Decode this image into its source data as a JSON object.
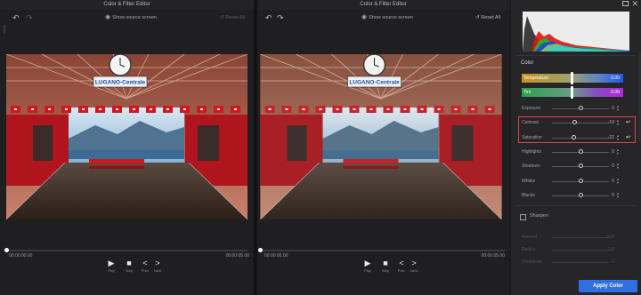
{
  "left_pane": {
    "title": "Color & Filter Editor",
    "show_source": "Show source screen",
    "reset_all": "Reset All",
    "time_start": "00:00:00.00",
    "time_end": "00:00:05.00"
  },
  "right_pane": {
    "title": "Color & Filter Editor",
    "show_source": "Show source screen",
    "reset_all": "Reset All",
    "time_start": "00:00:00.00",
    "time_end": "00:00:05.00"
  },
  "playback": {
    "play": "Play",
    "stop": "Stop",
    "prev": "Prev",
    "next": "Next"
  },
  "photo": {
    "sign_text": "LUGANO-Centrale"
  },
  "panel": {
    "color_section": "Color",
    "temperature": {
      "label": "Temperature",
      "value": "0.00",
      "level": 0.5
    },
    "tint": {
      "label": "Tint",
      "value": "0.00",
      "level": 0.5
    },
    "adjustments": [
      {
        "label": "Exposure",
        "value": "0",
        "level": 0.5
      },
      {
        "label": "Contrast",
        "value": "-19",
        "level": 0.4
      },
      {
        "label": "Saturation",
        "value": "-22",
        "level": 0.39
      },
      {
        "label": "Highlights",
        "value": "0",
        "level": 0.5
      },
      {
        "label": "Shadows",
        "value": "0",
        "level": 0.5
      },
      {
        "label": "Whites",
        "value": "0",
        "level": 0.5
      },
      {
        "label": "Blacks",
        "value": "0",
        "level": 0.5
      }
    ],
    "sharpen_label": "Sharpen",
    "sharpen_sliders": [
      {
        "label": "Amount",
        "value": "100"
      },
      {
        "label": "Radius",
        "value": "1.0"
      },
      {
        "label": "Threshold",
        "value": "0"
      }
    ],
    "apply_label": "Apply Color"
  },
  "colors": {
    "accent_blue": "#2f6fe0",
    "highlight_red": "#e84545"
  }
}
